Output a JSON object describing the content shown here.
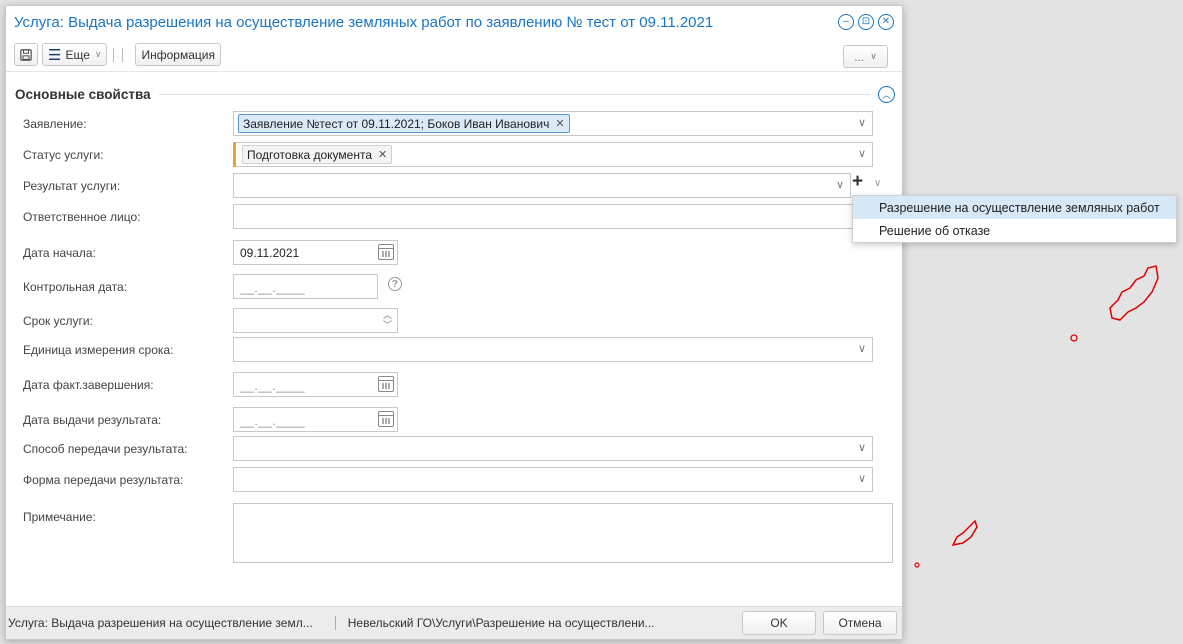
{
  "window": {
    "title": "Услуга: Выдача разрешения на осуществление земляных работ по заявлению № тест от 09.11.2021"
  },
  "toolbar": {
    "more_label": "Еще",
    "info_label": "Информация",
    "extra_label": "..."
  },
  "section": {
    "title": "Основные свойства"
  },
  "fields": {
    "application": {
      "label": "Заявление:",
      "tag": "Заявление №тест от 09.11.2021; Боков Иван Иванович"
    },
    "status": {
      "label": "Статус услуги:",
      "tag": "Подготовка документа"
    },
    "result": {
      "label": "Результат услуги:"
    },
    "responsible": {
      "label": "Ответственное лицо:"
    },
    "start_date": {
      "label": "Дата начала:",
      "value": "09.11.2021"
    },
    "control_date": {
      "label": "Контрольная дата:",
      "placeholder": "__.__.____"
    },
    "term": {
      "label": "Срок услуги:"
    },
    "term_unit": {
      "label": "Единица измерения срока:"
    },
    "actual_end": {
      "label": "Дата факт.завершения:",
      "placeholder": "__.__.____"
    },
    "issue_date": {
      "label": "Дата выдачи результата:",
      "placeholder": "__.__.____"
    },
    "transfer_method": {
      "label": "Способ передачи результата:"
    },
    "transfer_form": {
      "label": "Форма передачи результата:"
    },
    "note": {
      "label": "Примечание:"
    }
  },
  "result_dropdown": {
    "items": [
      "Разрешение на осуществление земляных работ",
      "Решение об отказе"
    ]
  },
  "statusbar": {
    "left_text": "Услуга: Выдача разрешения на осуществление земл...",
    "path_text": "Невельский ГО\\Услуги\\Разрешение на осуществлени...",
    "ok_label": "OK",
    "cancel_label": "Отмена"
  },
  "colors": {
    "accent": "#1a75c2",
    "status_marker": "#e8a33c",
    "dropdown_highlight": "#d7e8f7",
    "map_outline": "#e00000"
  }
}
